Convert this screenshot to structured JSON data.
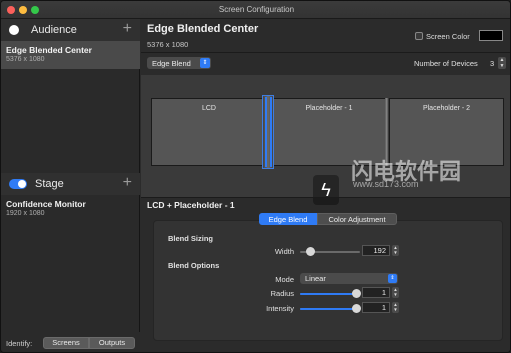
{
  "window": {
    "title": "Screen Configuration"
  },
  "sidebar": {
    "audience": {
      "label": "Audience",
      "add": "+"
    },
    "audience_devices": [
      {
        "name": "Edge Blended Center",
        "resolution": "5376 x 1080"
      }
    ],
    "stage": {
      "label": "Stage",
      "add": "+"
    },
    "stage_devices": [
      {
        "name": "Confidence Monitor",
        "resolution": "1920 x 1080"
      }
    ],
    "identify": {
      "label": "Identify:",
      "screens": "Screens",
      "outputs": "Outputs"
    }
  },
  "main": {
    "title": "Edge Blended Center",
    "resolution": "5376 x 1080",
    "screen_color_label": "Screen Color",
    "mode": "Edge Blend",
    "num_devices_label": "Number of Devices",
    "num_devices": "3",
    "screens": [
      "LCD",
      "Placeholder - 1",
      "Placeholder - 2"
    ],
    "pair_title": "LCD + Placeholder - 1",
    "tabs": [
      "Edge Blend",
      "Color Adjustment"
    ],
    "blend_sizing": {
      "heading": "Blend Sizing",
      "width_label": "Width",
      "width_value": "192"
    },
    "blend_options": {
      "heading": "Blend Options",
      "mode_label": "Mode",
      "mode_value": "Linear",
      "radius_label": "Radius",
      "radius_value": "1",
      "intensity_label": "Intensity",
      "intensity_value": "1"
    }
  },
  "watermark": {
    "text": "闪电软件园",
    "url": "www.sd173.com"
  },
  "colors": {
    "accent": "#2f7bf5",
    "screen_color": "#000000"
  }
}
